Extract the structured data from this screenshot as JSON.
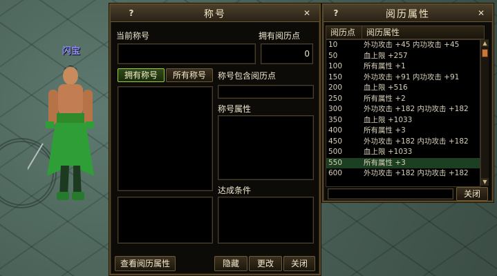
{
  "scene": {
    "player_name": "闪宝"
  },
  "title_window": {
    "title": "称号",
    "help_label": "?",
    "close_label": "✕",
    "current_title_label": "当前称号",
    "current_title_value": "",
    "owned_points_label": "拥有阅历点",
    "owned_points_value": "0",
    "tab_owned": "拥有称号",
    "tab_all": "所有称号",
    "title_points_label": "称号包含阅历点",
    "title_attr_label": "称号属性",
    "achieve_label": "达成条件",
    "view_attr_button": "查看阅历属性",
    "hide_button": "隐藏",
    "rename_button": "更改",
    "close_button": "关闭"
  },
  "attr_window": {
    "title": "阅历属性",
    "help_label": "?",
    "close_label": "✕",
    "col_points": "阅历点",
    "col_attr": "阅历属性",
    "rows": [
      {
        "points": "10",
        "effect": "外功攻击 +45  内功攻击 +45"
      },
      {
        "points": "50",
        "effect": "血上限 +257"
      },
      {
        "points": "100",
        "effect": "所有属性 +1"
      },
      {
        "points": "150",
        "effect": "外功攻击 +91  内功攻击 +91"
      },
      {
        "points": "200",
        "effect": "血上限 +516"
      },
      {
        "points": "250",
        "effect": "所有属性 +2"
      },
      {
        "points": "300",
        "effect": "外功攻击 +182  内功攻击 +182"
      },
      {
        "points": "350",
        "effect": "血上限 +1033"
      },
      {
        "points": "400",
        "effect": "所有属性 +3"
      },
      {
        "points": "450",
        "effect": "外功攻击 +182  内功攻击 +182"
      },
      {
        "points": "500",
        "effect": "血上限 +1033"
      },
      {
        "points": "550",
        "effect": "所有属性 +3"
      },
      {
        "points": "600",
        "effect": "外功攻击 +182  内功攻击 +182"
      }
    ],
    "selected_index": 11,
    "close_button": "关闭"
  }
}
